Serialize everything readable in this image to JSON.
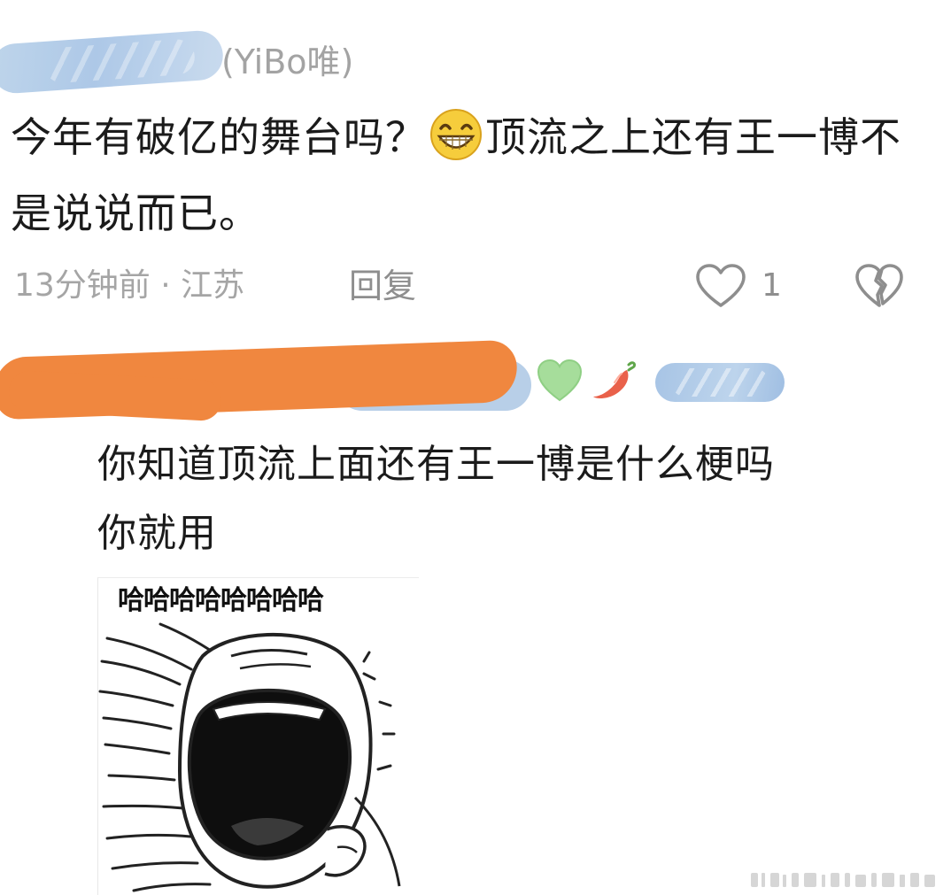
{
  "comment1": {
    "username_visible": "(YiBo唯)",
    "text_before_emoji": "今年有破亿的舞台吗？",
    "emoji": "grinning-face-emoji",
    "text_after_emoji": "顶流之上还有王一博不是说说而已。",
    "time_location": "13分钟前 · 江苏",
    "reply_label": "回复",
    "like_count": "1",
    "icons": [
      "heart-outline-icon",
      "broken-heart-icon"
    ]
  },
  "comment2": {
    "badges": [
      "green-heart-icon",
      "chili-pepper-icon"
    ],
    "text_line1": "你知道顶流上面还有王一博是什么梗吗",
    "text_line2": "你就用",
    "meme": {
      "caption": "哈哈哈哈哈哈哈哈",
      "depicts": "laughing-rage-face"
    }
  },
  "colors": {
    "text": "#1b1b1b",
    "meta": "#a5a5a5",
    "redaction_blue": "#a9c6e6",
    "redaction_orange": "#f0873f",
    "green_heart": "#a6dd9b",
    "chili": "#e9614a"
  }
}
